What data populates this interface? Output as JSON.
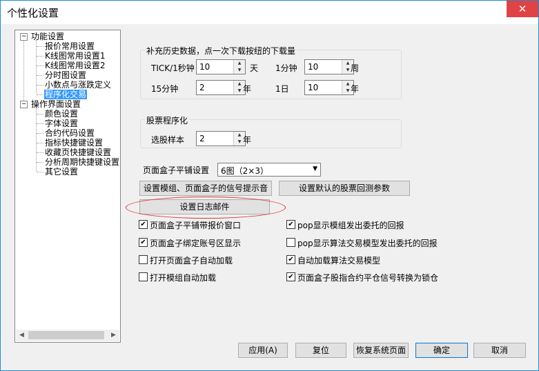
{
  "window": {
    "title": "个性化设置",
    "close_glyph": "✕",
    "close_icon": "close-icon"
  },
  "tree": {
    "groups": [
      {
        "label": "功能设置",
        "expander": "−",
        "items": [
          "报价常用设置",
          "K线图常用设置1",
          "K线图常用设置2",
          "分时图设置",
          "小数点与涨跌定义",
          "程序化交易"
        ]
      },
      {
        "label": "操作界面设置",
        "expander": "−",
        "items": [
          "颜色设置",
          "字体设置",
          "合约代码设置",
          "指标快捷键设置",
          "收藏页快捷键设置",
          "分析周期快捷键设置",
          "其它设置"
        ]
      }
    ],
    "selected": "程序化交易",
    "scroll_left_glyph": "◀",
    "scroll_right_glyph": "▶"
  },
  "history": {
    "legend": "补充历史数据，点一次下载按纽的下载量",
    "rows": [
      {
        "label": "TICK/1秒钟",
        "value": "10",
        "unit": "天"
      },
      {
        "label": "1分钟",
        "value": "10",
        "unit": "周"
      },
      {
        "label": "15分钟",
        "value": "2",
        "unit": "年"
      },
      {
        "label": "1日",
        "value": "10",
        "unit": "年"
      }
    ]
  },
  "stock": {
    "legend": "股票程序化",
    "label": "选股样本",
    "value": "2",
    "unit": "年"
  },
  "spin_up_glyph": "▲",
  "spin_down_glyph": "▼",
  "layout_select": {
    "label": "页面盒子平铺设置",
    "value": "6图（2×3）",
    "arrow": "▼"
  },
  "buttons": {
    "signal_sound": "设置模组、页面盒子的信号提示音",
    "default_backtest": "设置默认的股票回测参数",
    "log_email": "设置日志邮件",
    "apply": "应用(A)",
    "reset": "复位",
    "restore_system": "恢复系统页面",
    "ok": "确定",
    "cancel": "取消"
  },
  "check_mark": "✔",
  "checkboxes": [
    {
      "label": "页面盒子平铺带报价窗口",
      "checked": true
    },
    {
      "label": "pop显示模组发出委托的回报",
      "checked": true
    },
    {
      "label": "页面盒子绑定账号区显示",
      "checked": true
    },
    {
      "label": "pop显示算法交易模型发出委托的回报",
      "checked": false
    },
    {
      "label": "打开页面盒子自动加载",
      "checked": false
    },
    {
      "label": "自动加载算法交易模型",
      "checked": true
    },
    {
      "label": "打开模组自动加载",
      "checked": false
    },
    {
      "label": "页面盒子股指合约平仓信号转换为锁仓",
      "checked": true
    }
  ]
}
